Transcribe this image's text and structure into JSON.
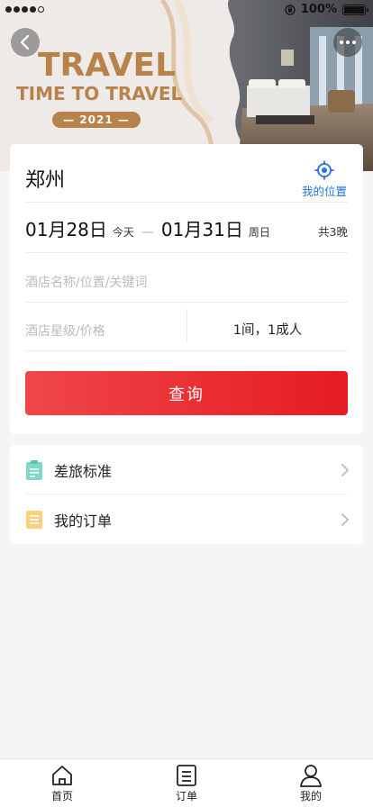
{
  "status_bar": {
    "battery": "100%",
    "signal_icon": "signal-dots-icon",
    "lock_icon": "orientation-lock-icon"
  },
  "banner": {
    "title": "TRAVEL",
    "subtitle": "TIME TO TRAVEL",
    "year": "— 2021 —",
    "accent_color": "#b8834a"
  },
  "search": {
    "city": "郑州",
    "location_label": "我的位置",
    "checkin_date": "01月28日",
    "checkin_day": "今天",
    "separator": "—",
    "checkout_date": "01月31日",
    "checkout_day": "周日",
    "nights": "共3晚",
    "keyword_placeholder": "酒店名称/位置/关键词",
    "star_placeholder": "酒店星级/价格",
    "guests": "1间，1成人",
    "query_button": "查询",
    "button_color": "#e51c22",
    "link_color": "#2673d6"
  },
  "menu": {
    "items": [
      {
        "label": "差旅标准",
        "icon": "clipboard-icon",
        "icon_color": "#7fd8c6"
      },
      {
        "label": "我的订单",
        "icon": "order-list-icon",
        "icon_color": "#ffcf7a"
      }
    ]
  },
  "tabbar": {
    "items": [
      {
        "label": "首页",
        "icon": "home-icon"
      },
      {
        "label": "订单",
        "icon": "order-icon"
      },
      {
        "label": "我的",
        "icon": "user-icon"
      }
    ]
  }
}
